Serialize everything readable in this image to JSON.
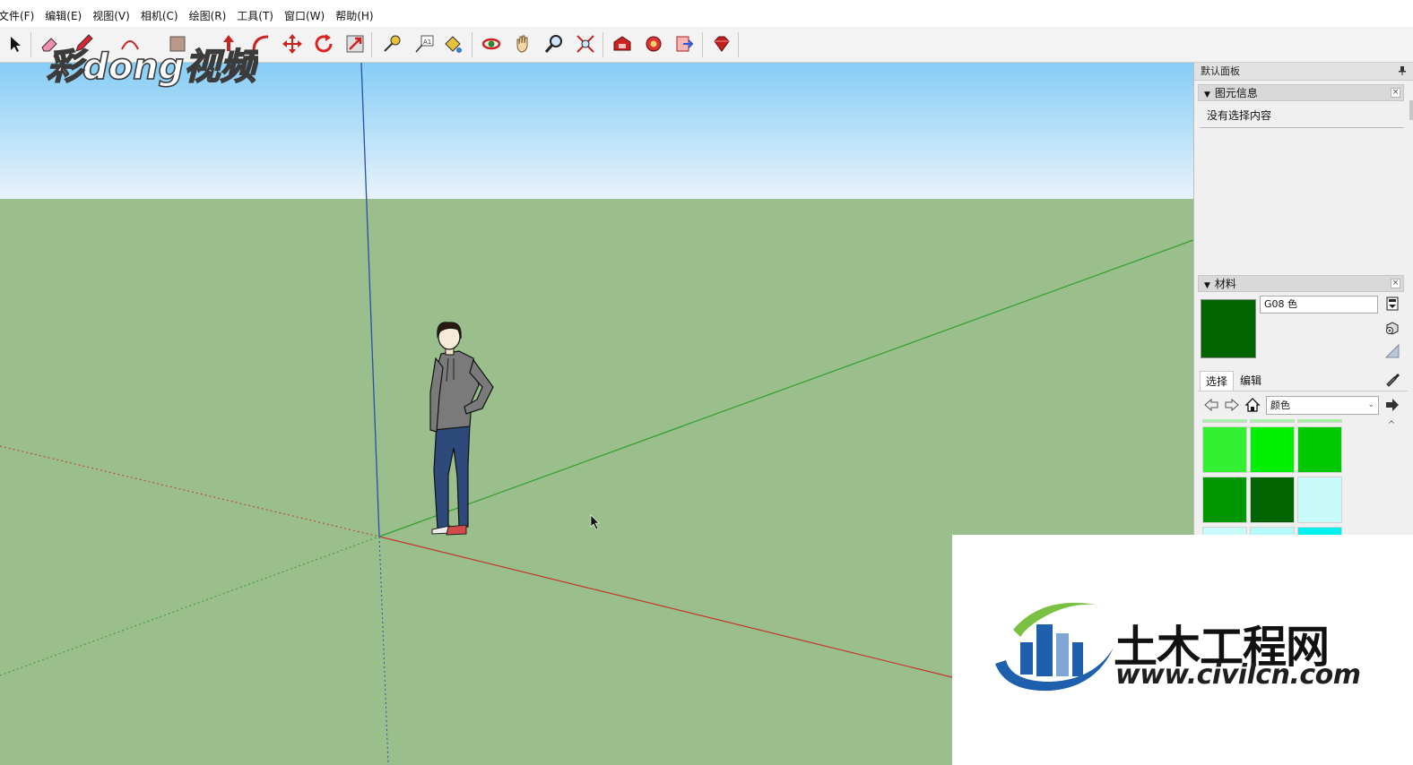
{
  "menubar": {
    "items": [
      "文件(F)",
      "编辑(E)",
      "视图(V)",
      "相机(C)",
      "绘图(R)",
      "工具(T)",
      "窗口(W)",
      "帮助(H)"
    ]
  },
  "toolbar": {
    "tools": [
      "select-arrow-icon",
      "eraser-icon",
      "pencil-icon",
      "arc-icon",
      "rectangle-icon",
      "push-pull-icon",
      "offset-icon",
      "move-icon",
      "rotate-icon",
      "scale-icon",
      "tape-measure-icon",
      "text-icon",
      "paint-bucket-icon",
      "orbit-icon",
      "pan-icon",
      "zoom-icon",
      "zoom-extents-icon",
      "warehouse-icon",
      "share-model-icon",
      "send-to-layout-icon",
      "ruby-extension-icon"
    ]
  },
  "watermark": {
    "brand": "彩dong视频",
    "civil_title": "土木工程网",
    "civil_url": "www.civilcn.com"
  },
  "colors": {
    "sky_top": "#86cdf6",
    "sky_bottom": "#e8f3fb",
    "ground": "#9bbf8c",
    "axis_red": "#c0392b",
    "axis_green": "#2e9e2e",
    "axis_blue": "#2a4fa8",
    "current_material": "#006400"
  },
  "tray": {
    "title": "默认面板",
    "entity_info": {
      "header": "图元信息",
      "empty_text": "没有选择内容"
    },
    "materials": {
      "header": "材料",
      "current_name": "G08 色",
      "tabs": [
        "选择",
        "编辑"
      ],
      "library": "颜色",
      "swatches": [
        [
          "#a8f0a8",
          "#a8f0a8",
          "#a0f0a0"
        ],
        [
          "#33f033",
          "#00f000",
          "#00c800"
        ],
        [
          "#009600",
          "#006400",
          "#c8fafa"
        ],
        [
          "#c8fafa",
          "#b4fafa",
          "#00f0f0"
        ]
      ]
    }
  }
}
